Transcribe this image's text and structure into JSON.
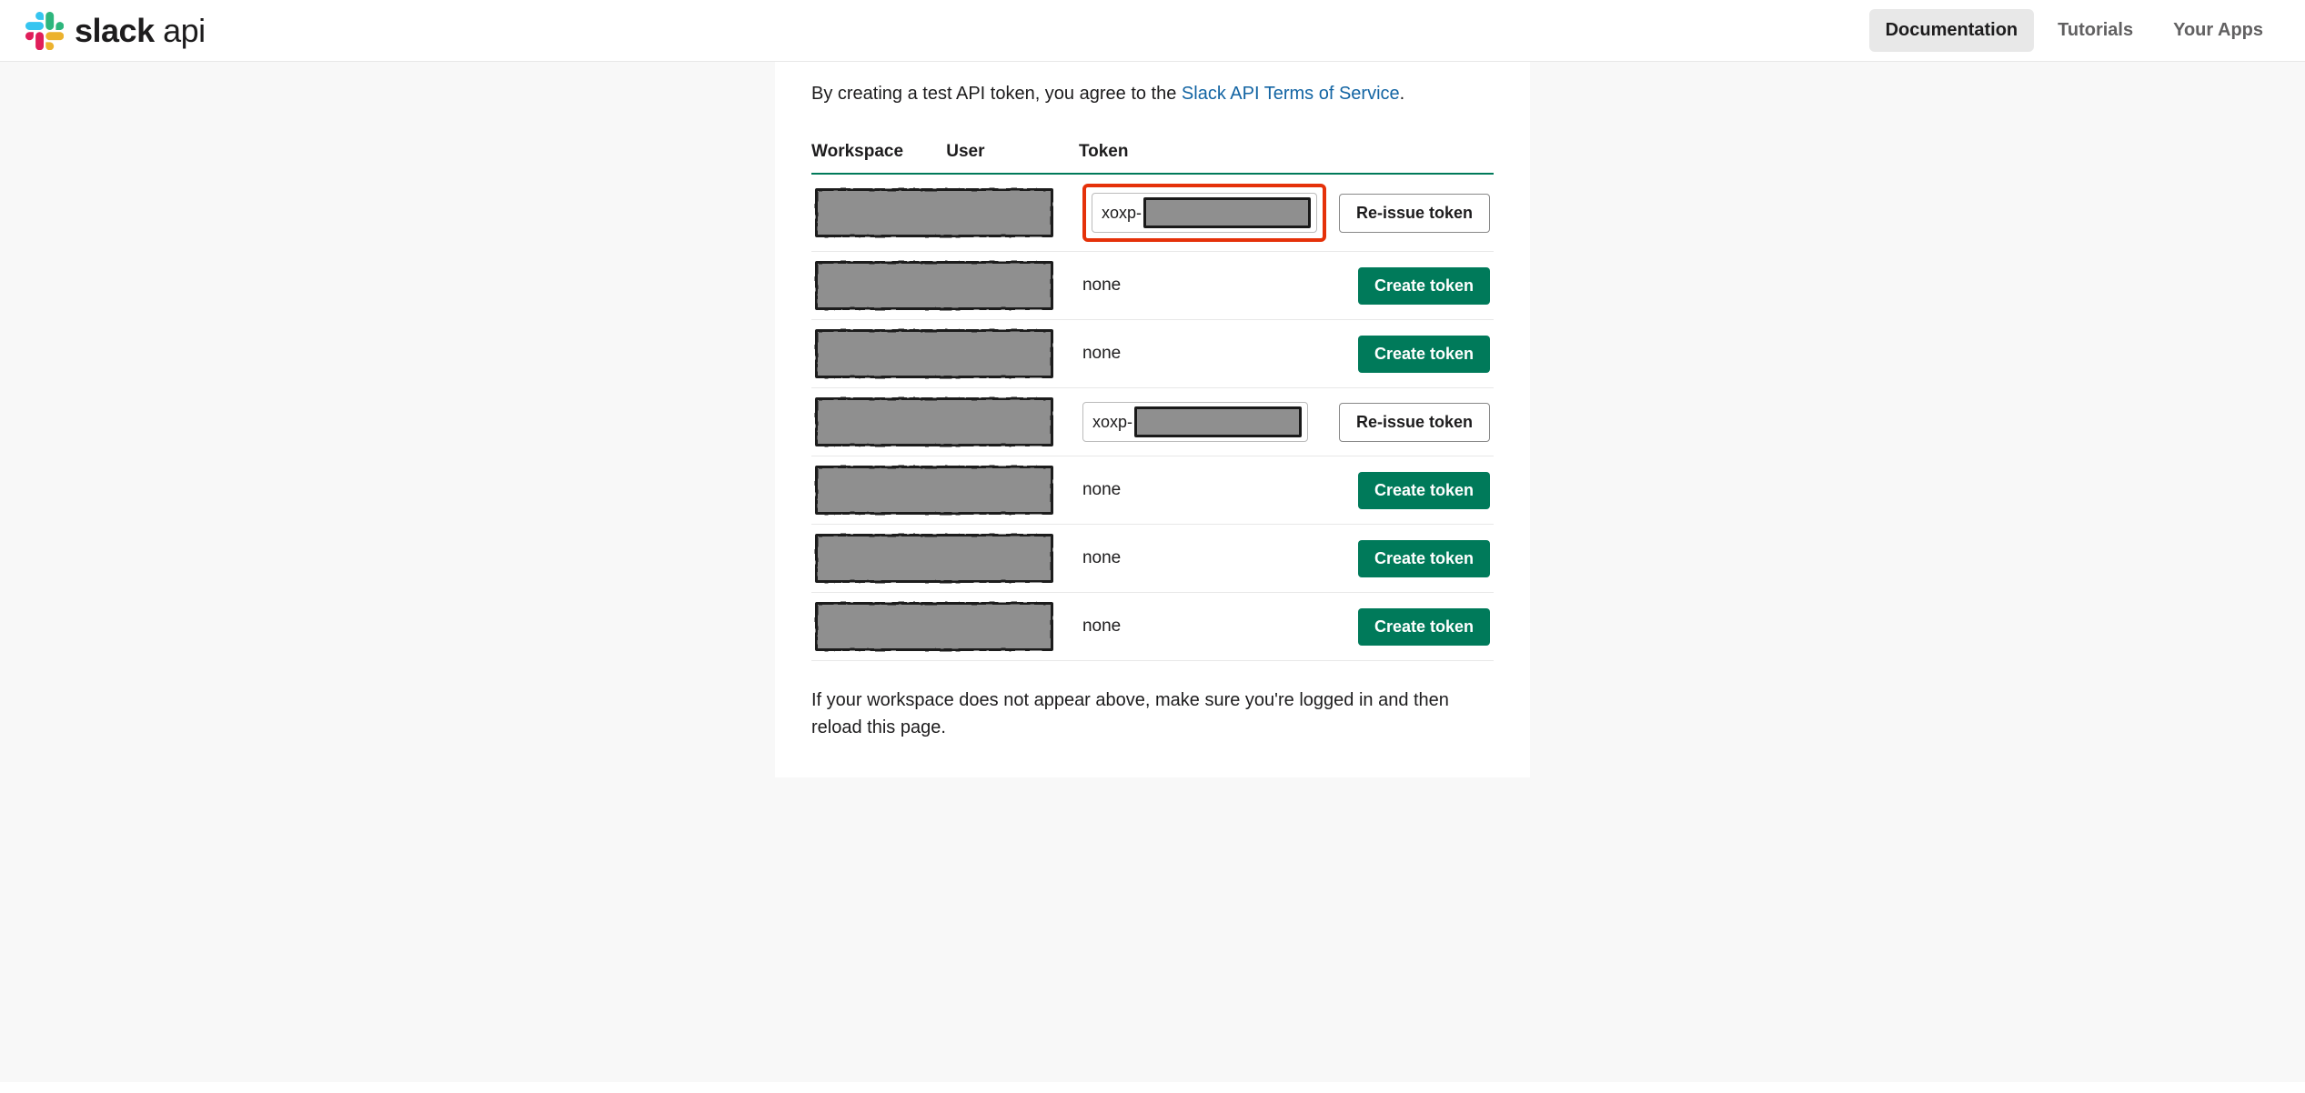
{
  "header": {
    "logo_text_main": "slack",
    "logo_text_sub": " api",
    "nav": [
      {
        "label": "Documentation",
        "active": true
      },
      {
        "label": "Tutorials",
        "active": false
      },
      {
        "label": "Your Apps",
        "active": false
      }
    ]
  },
  "intro": {
    "prefix": "By creating a test API token, you agree to the ",
    "link_text": "Slack API Terms of Service",
    "suffix": "."
  },
  "table": {
    "headers": {
      "workspace": "Workspace",
      "user": "User",
      "token": "Token"
    },
    "rows": [
      {
        "token_type": "xoxp",
        "token_prefix": "xoxp-",
        "action": "reissue",
        "action_label": "Re-issue token",
        "highlighted": true
      },
      {
        "token_type": "none",
        "none_label": "none",
        "action": "create",
        "action_label": "Create token"
      },
      {
        "token_type": "none",
        "none_label": "none",
        "action": "create",
        "action_label": "Create token"
      },
      {
        "token_type": "xoxp",
        "token_prefix": "xoxp-",
        "action": "reissue",
        "action_label": "Re-issue token",
        "highlighted": false
      },
      {
        "token_type": "none",
        "none_label": "none",
        "action": "create",
        "action_label": "Create token"
      },
      {
        "token_type": "none",
        "none_label": "none",
        "action": "create",
        "action_label": "Create token"
      },
      {
        "token_type": "none",
        "none_label": "none",
        "action": "create",
        "action_label": "Create token"
      }
    ]
  },
  "footer_text": "If your workspace does not appear above, make sure you're logged in and then reload this page."
}
